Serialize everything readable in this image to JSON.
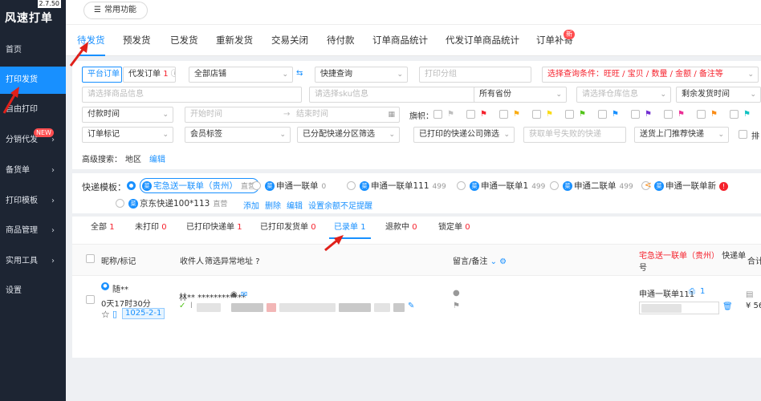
{
  "app": {
    "title": "风速打单",
    "version": "2.7.50"
  },
  "sidebar": {
    "items": [
      {
        "label": "首页",
        "active": false,
        "chevron": false,
        "badge": ""
      },
      {
        "label": "打印发货",
        "active": true,
        "chevron": false,
        "badge": ""
      },
      {
        "label": "自由打印",
        "active": false,
        "chevron": false,
        "badge": ""
      },
      {
        "label": "分销代发",
        "active": false,
        "chevron": true,
        "badge": "NEW"
      },
      {
        "label": "备货单",
        "active": false,
        "chevron": true,
        "badge": ""
      },
      {
        "label": "打印模板",
        "active": false,
        "chevron": true,
        "badge": ""
      },
      {
        "label": "商品管理",
        "active": false,
        "chevron": true,
        "badge": ""
      },
      {
        "label": "实用工具",
        "active": false,
        "chevron": true,
        "badge": ""
      },
      {
        "label": "设置",
        "active": false,
        "chevron": false,
        "badge": ""
      }
    ]
  },
  "topbar": {
    "quick_label": "常用功能"
  },
  "tabs": [
    {
      "label": "待发货",
      "badge": ""
    },
    {
      "label": "预发货",
      "badge": ""
    },
    {
      "label": "已发货",
      "badge": ""
    },
    {
      "label": "重新发货",
      "badge": ""
    },
    {
      "label": "交易关闭",
      "badge": ""
    },
    {
      "label": "待付款",
      "badge": ""
    },
    {
      "label": "订单商品统计",
      "badge": ""
    },
    {
      "label": "代发订单商品统计",
      "badge": ""
    },
    {
      "label": "订单补寄",
      "badge": "新"
    }
  ],
  "filters": {
    "platform_order": "平台订单",
    "proxy_order": "代发订单",
    "proxy_order_count": "1",
    "all_shops": "全部店铺",
    "quick_query": "快捷查询",
    "print_group_ph": "打印分组",
    "select_conditions": "选择查询条件：旺旺 / 宝贝 / 数量 / 金额 / 备注等",
    "product_info_ph": "请选择商品信息",
    "sku_info_ph": "请选择sku信息",
    "all_provinces": "所有省份",
    "warehouse_ph": "请选择仓库信息",
    "remaining_time": "剩余发货时间",
    "pay_time": "付款时间",
    "start_time_ph": "开始时间",
    "end_time_ph": "结束时间",
    "flag_label": "旗帜：",
    "order_mark": "订单标记",
    "member_tag": "会员标签",
    "assigned_express": "已分配快递分区筛选",
    "printed_express": "已打印的快递公司筛选",
    "failed_ph": "获取单号失败的快递",
    "door_delivery": "送货上门推荐快递",
    "sort_label": "排",
    "advanced_label": "高级搜索：",
    "region_label": "地区",
    "edit_label": "编辑",
    "flag_colors": [
      "#bfbfbf",
      "#f5222d",
      "#faad14",
      "#fadb14",
      "#52c41a",
      "#1890ff",
      "#722ed1",
      "#eb2f96",
      "#fa8c16",
      "#13c2c2"
    ]
  },
  "templates": {
    "label": "快递模板：",
    "items": [
      {
        "name": "宅急送一联单（贵州）",
        "tag": "直营",
        "count": ""
      },
      {
        "name": "申通一联单",
        "tag": "",
        "count": "0"
      },
      {
        "name": "申通一联单111",
        "tag": "",
        "count": "499"
      },
      {
        "name": "申通一联单1",
        "tag": "",
        "count": "499"
      },
      {
        "name": "申通二联单",
        "tag": "",
        "count": "499"
      },
      {
        "name": "申通一联单新",
        "tag": "",
        "count": ""
      },
      {
        "name": "京东快递100*113",
        "tag": "直营",
        "count": ""
      }
    ],
    "add": "添加",
    "delete": "删除",
    "edit": "编辑",
    "balance_alert": "设置余额不足提醒"
  },
  "order_tabs": [
    {
      "label": "全部",
      "count": "1"
    },
    {
      "label": "未打印",
      "count": "0"
    },
    {
      "label": "已打印快递单",
      "count": "1"
    },
    {
      "label": "已打印发货单",
      "count": "0"
    },
    {
      "label": "已录单",
      "count": "1"
    },
    {
      "label": "退款中",
      "count": "0"
    },
    {
      "label": "锁定单",
      "count": "0"
    }
  ],
  "table": {
    "headers": {
      "nickname": "昵称/标记",
      "receiver": "收件人",
      "filter_abnormal": "筛选异常地址",
      "remarks": "留言/备注",
      "express_red": "宅急送一联单（贵州）",
      "express_suffix": "快递单",
      "express_suffix2": "号",
      "total": "合计"
    },
    "row": {
      "nickname": "随**",
      "time_left": "0天17时30分",
      "tag": "1025-2-1",
      "receiver_name": "林** ************",
      "express_name": "申通一联单111",
      "express_count": "1",
      "price": "¥ 56"
    }
  }
}
